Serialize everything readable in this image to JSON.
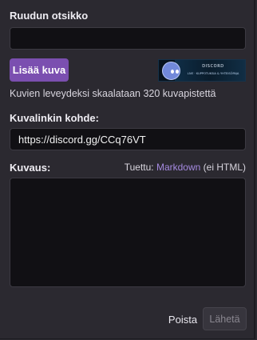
{
  "form": {
    "title_label": "Ruudun otsikko",
    "title_value": "",
    "add_image_button": "Lisää kuva",
    "image": {
      "banner_title": "DISCORD",
      "banner_subtitle": "LIVE · KUPPOTUKSIA & YHTEISÖPAJA",
      "alt": "Discord banner"
    },
    "image_help": "Kuvien leveydeksi skaalataan 320 kuvapistettä",
    "link_label": "Kuvalinkin kohde:",
    "link_value": "https://discord.gg/CCq76VT",
    "description_label": "Kuvaus:",
    "supported_prefix": "Tuettu: ",
    "supported_link": "Markdown",
    "supported_suffix": " (ei HTML)",
    "description_value": "",
    "delete_button": "Poista",
    "submit_button": "Lähetä"
  },
  "colors": {
    "background": "#2b2930",
    "input_background": "#111014",
    "accent": "#7b4fb0",
    "link": "#a58ae0"
  }
}
